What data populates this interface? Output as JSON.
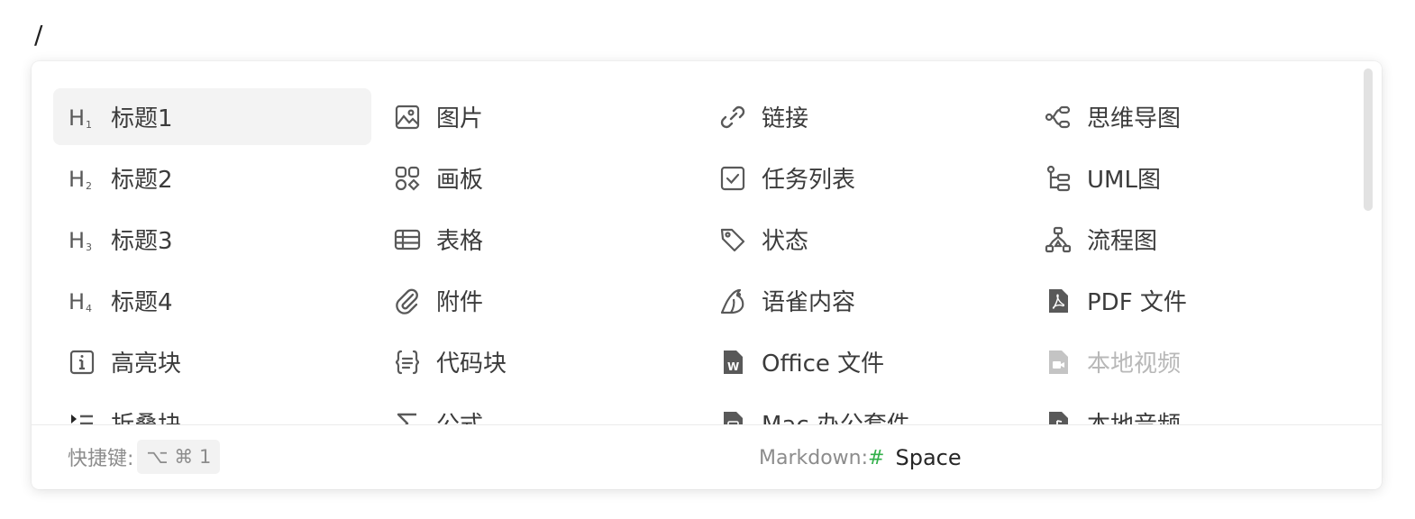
{
  "input_text": "/",
  "menu": {
    "items": [
      {
        "label": "标题1",
        "icon": "heading-1-icon",
        "active": true
      },
      {
        "label": "图片",
        "icon": "image-icon"
      },
      {
        "label": "链接",
        "icon": "link-icon"
      },
      {
        "label": "思维导图",
        "icon": "mindmap-icon"
      },
      {
        "label": "标题2",
        "icon": "heading-2-icon"
      },
      {
        "label": "画板",
        "icon": "board-icon"
      },
      {
        "label": "任务列表",
        "icon": "checkbox-icon"
      },
      {
        "label": "UML图",
        "icon": "uml-icon"
      },
      {
        "label": "标题3",
        "icon": "heading-3-icon"
      },
      {
        "label": "表格",
        "icon": "table-icon"
      },
      {
        "label": "状态",
        "icon": "tag-icon"
      },
      {
        "label": "流程图",
        "icon": "flowchart-icon"
      },
      {
        "label": "标题4",
        "icon": "heading-4-icon"
      },
      {
        "label": "附件",
        "icon": "paperclip-icon"
      },
      {
        "label": "语雀内容",
        "icon": "yuque-bird-icon"
      },
      {
        "label": "PDF 文件",
        "icon": "pdf-file-icon"
      },
      {
        "label": "高亮块",
        "icon": "info-icon"
      },
      {
        "label": "代码块",
        "icon": "code-block-icon"
      },
      {
        "label": "Office 文件",
        "icon": "word-file-icon"
      },
      {
        "label": "本地视频",
        "icon": "video-file-icon",
        "disabled": true
      },
      {
        "label": "折叠块",
        "icon": "collapse-list-icon"
      },
      {
        "label": "公式",
        "icon": "sigma-icon"
      },
      {
        "label": "Mac 办公套件",
        "icon": "mac-file-icon"
      },
      {
        "label": "本地音频",
        "icon": "audio-file-icon"
      }
    ]
  },
  "footer": {
    "shortcut_label": "快捷键:",
    "shortcut_keys": "⌥ ⌘ 1",
    "markdown_label": "Markdown:",
    "markdown_hash": "#",
    "markdown_key": "Space"
  },
  "colors": {
    "accent_green": "#32b04a",
    "active_bg": "#f3f3f3",
    "icon_gray": "#595959"
  }
}
